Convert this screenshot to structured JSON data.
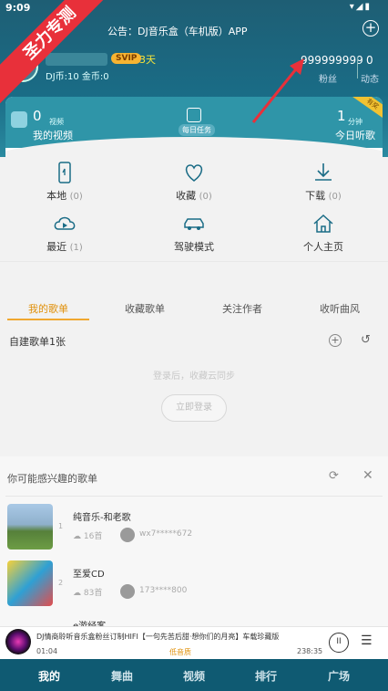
{
  "status": {
    "time": "9:09",
    "icons": "▾◢▮"
  },
  "banner": {
    "text": "圣力专测"
  },
  "header": {
    "notice": "公告：DJ音乐盒（车机版）APP",
    "add_symbol": "+",
    "vip_label": "SVIP",
    "vip_days": "3天",
    "coins": "DJ币:10 金币:0",
    "fans_count": "999999999",
    "fans_label": "粉丝",
    "dynamic_count": "0",
    "dynamic_label": "动态"
  },
  "card": {
    "video_count": "0",
    "video_unit": "视频",
    "video_label": "我的视频",
    "task_label": "每日任务",
    "listen_count": "1",
    "listen_unit": "分钟",
    "listen_label": "今日听歌",
    "ribbon": "有奖"
  },
  "grid": [
    {
      "label": "本地",
      "count": "(0)"
    },
    {
      "label": "收藏",
      "count": "(0)"
    },
    {
      "label": "下载",
      "count": "(0)"
    },
    {
      "label": "最近",
      "count": "(1)"
    },
    {
      "label": "驾驶模式",
      "count": ""
    },
    {
      "label": "个人主页",
      "count": ""
    }
  ],
  "tabs": [
    "我的歌单",
    "收藏歌单",
    "关注作者",
    "收听曲风"
  ],
  "self_playlists": {
    "title": "自建歌单1张",
    "plus": "+",
    "history": "↺"
  },
  "login": {
    "hint": "登录后，收藏云同步",
    "button": "立即登录"
  },
  "recommend": {
    "title": "你可能感兴趣的歌单",
    "refresh": "⟳",
    "close": "✕",
    "items": [
      {
        "rank": "1",
        "title": "纯音乐-和老歌",
        "count": "16首",
        "user": "wx7*****672"
      },
      {
        "rank": "2",
        "title": "至爱CD",
        "count": "83首",
        "user": "173****800"
      }
    ],
    "partial_title": "e游经客"
  },
  "player": {
    "title": "DJ情商聆听音乐盒粉丝订制HIFI【一句先苦后甜·想你们的月亮】车载珍藏版",
    "current": "01:04",
    "quality": "低音质",
    "total": "238:35",
    "pause": "II",
    "playlist": "☰"
  },
  "bottom_nav": [
    "我的",
    "舞曲",
    "视频",
    "排行",
    "广场"
  ],
  "colors": {
    "accent": "#e0900a",
    "header": "#1a6c86",
    "nav": "#0f5a72",
    "banner": "#e8303a"
  }
}
